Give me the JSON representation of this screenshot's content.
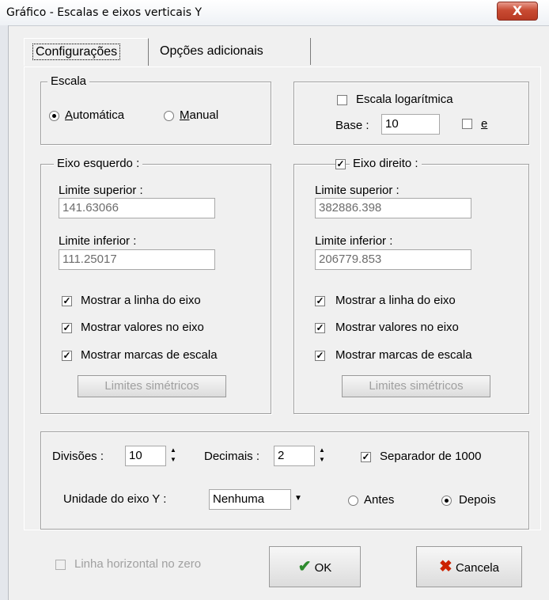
{
  "window": {
    "title": "Gráfico - Escalas e eixos verticais Y",
    "close_glyph": "X"
  },
  "tabs": [
    {
      "label": "Configurações"
    },
    {
      "label": "Opções adicionais"
    }
  ],
  "escala": {
    "legend": "Escala",
    "auto_label": "Automática",
    "manual_label": "Manual",
    "selected": "Automática"
  },
  "log": {
    "label": "Escala logarítmica",
    "checked": false,
    "base_label": "Base :",
    "base_value": "10",
    "e_label": "e",
    "e_checked": false
  },
  "left_axis": {
    "legend": "Eixo esquerdo :",
    "upper_label": "Limite superior :",
    "upper_value": "141.63066",
    "lower_label": "Limite inferior :",
    "lower_value": "111.25017",
    "show_line": "Mostrar a linha do eixo",
    "show_values": "Mostrar valores no eixo",
    "show_ticks": "Mostrar marcas de escala",
    "sym_button": "Limites simétricos"
  },
  "right_axis": {
    "legend": "Eixo direito :",
    "enabled": true,
    "upper_label": "Limite superior :",
    "upper_value": "382886.398",
    "lower_label": "Limite inferior :",
    "lower_value": "206779.853",
    "show_line": "Mostrar a linha do eixo",
    "show_values": "Mostrar valores no eixo",
    "show_ticks": "Mostrar marcas de escala",
    "sym_button": "Limites simétricos"
  },
  "bottom": {
    "divisions_label": "Divisões :",
    "divisions_value": "10",
    "decimals_label": "Decimais :",
    "decimals_value": "2",
    "separator_label": "Separador de 1000",
    "separator_checked": true,
    "unit_label": "Unidade do eixo Y :",
    "unit_value": "Nenhuma",
    "before_label": "Antes",
    "after_label": "Depois",
    "position_selected": "Depois"
  },
  "footer": {
    "zero_line_label": "Linha horizontal no zero",
    "ok_label": "OK",
    "cancel_label": "Cancela"
  },
  "colors": {
    "ok_icon": "#2e8b2e",
    "cancel_icon": "#cc2200",
    "close_button": "#c94b33"
  }
}
